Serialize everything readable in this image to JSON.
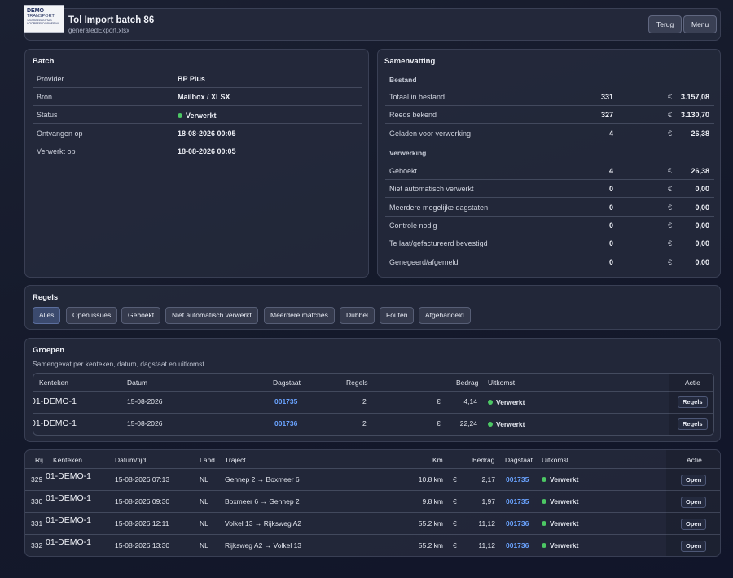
{
  "header": {
    "logo": {
      "line1": "DEMO",
      "line2": "TRANSPORT",
      "line3": "VOORBEELDSTAD",
      "line4": "VOORBEELDGROEP NL"
    },
    "title": "Tol Import batch 86",
    "subtitle": "generatedExport.xlsx",
    "back_label": "Terug",
    "menu_label": "Menu"
  },
  "batch": {
    "title": "Batch",
    "rows": [
      {
        "label": "Provider",
        "value": "BP Plus"
      },
      {
        "label": "Bron",
        "value": "Mailbox / XLSX"
      },
      {
        "label": "Status",
        "value": "Verwerkt"
      },
      {
        "label": "Ontvangen op",
        "value": "18-08-2026 00:05"
      },
      {
        "label": "Verwerkt op",
        "value": "18-08-2026 00:05"
      }
    ]
  },
  "summary": {
    "title": "Samenvatting",
    "file_section": "Bestand",
    "file_rows": [
      {
        "label": "Totaal in bestand",
        "count": "331",
        "currency": "€",
        "amount": "3.157,08"
      },
      {
        "label": "Reeds bekend",
        "count": "327",
        "currency": "€",
        "amount": "3.130,70"
      },
      {
        "label": "Geladen voor verwerking",
        "count": "4",
        "currency": "€",
        "amount": "26,38"
      }
    ],
    "processing_section": "Verwerking",
    "processing_rows": [
      {
        "label": "Geboekt",
        "count": "4",
        "currency": "€",
        "amount": "26,38"
      },
      {
        "label": "Niet automatisch verwerkt",
        "count": "0",
        "currency": "€",
        "amount": "0,00"
      },
      {
        "label": "Meerdere mogelijke dagstaten",
        "count": "0",
        "currency": "€",
        "amount": "0,00"
      },
      {
        "label": "Controle nodig",
        "count": "0",
        "currency": "€",
        "amount": "0,00"
      },
      {
        "label": "Te laat/gefactureerd bevestigd",
        "count": "0",
        "currency": "€",
        "amount": "0,00"
      },
      {
        "label": "Genegeerd/afgemeld",
        "count": "0",
        "currency": "€",
        "amount": "0,00"
      }
    ]
  },
  "rules": {
    "title": "Regels",
    "filters": [
      "Alles",
      "Open issues",
      "Geboekt",
      "Niet automatisch verwerkt",
      "Meerdere matches",
      "Dubbel",
      "Fouten",
      "Afgehandeld"
    ],
    "active": "Alles"
  },
  "groups": {
    "title": "Groepen",
    "subtitle": "Samengevat per kenteken, datum, dagstaat en uitkomst.",
    "headers": {
      "plate": "Kenteken",
      "date": "Datum",
      "daystate": "Dagstaat",
      "rules": "Regels",
      "amount": "Bedrag",
      "outcome": "Uitkomst",
      "action": "Actie"
    },
    "rows": [
      {
        "plate": "01-DEMO-1",
        "date": "15-08-2026",
        "daystate": "001735",
        "rules": "2",
        "currency": "€",
        "amount": "4,14",
        "outcome": "Verwerkt",
        "action": "Regels"
      },
      {
        "plate": "01-DEMO-1",
        "date": "15-08-2026",
        "daystate": "001736",
        "rules": "2",
        "currency": "€",
        "amount": "22,24",
        "outcome": "Verwerkt",
        "action": "Regels"
      }
    ]
  },
  "lines": {
    "headers": {
      "row": "Rij",
      "plate": "Kenteken",
      "datetime": "Datum/tijd",
      "country": "Land",
      "route": "Traject",
      "km": "Km",
      "amount": "Bedrag",
      "daystate": "Dagstaat",
      "outcome": "Uitkomst",
      "action": "Actie"
    },
    "rows": [
      {
        "row": "329",
        "plate": "01-DEMO-1",
        "datetime": "15-08-2026 07:13",
        "country": "NL",
        "route": "Gennep 2 → Boxmeer 6",
        "km": "10.8 km",
        "currency": "€",
        "amount": "2,17",
        "daystate": "001735",
        "outcome": "Verwerkt",
        "action": "Open"
      },
      {
        "row": "330",
        "plate": "01-DEMO-1",
        "datetime": "15-08-2026 09:30",
        "country": "NL",
        "route": "Boxmeer 6 → Gennep 2",
        "km": "9.8 km",
        "currency": "€",
        "amount": "1,97",
        "daystate": "001735",
        "outcome": "Verwerkt",
        "action": "Open"
      },
      {
        "row": "331",
        "plate": "01-DEMO-1",
        "datetime": "15-08-2026 12:11",
        "country": "NL",
        "route": "Volkel 13 → Rijksweg A2",
        "km": "55.2 km",
        "currency": "€",
        "amount": "11,12",
        "daystate": "001736",
        "outcome": "Verwerkt",
        "action": "Open"
      },
      {
        "row": "332",
        "plate": "01-DEMO-1",
        "datetime": "15-08-2026 13:30",
        "country": "NL",
        "route": "Rijksweg A2 → Volkel 13",
        "km": "55.2 km",
        "currency": "€",
        "amount": "11,12",
        "daystate": "001736",
        "outcome": "Verwerkt",
        "action": "Open"
      }
    ]
  },
  "colors": {
    "accent_link": "#6aa3ff",
    "status_ok": "#4cc764"
  }
}
